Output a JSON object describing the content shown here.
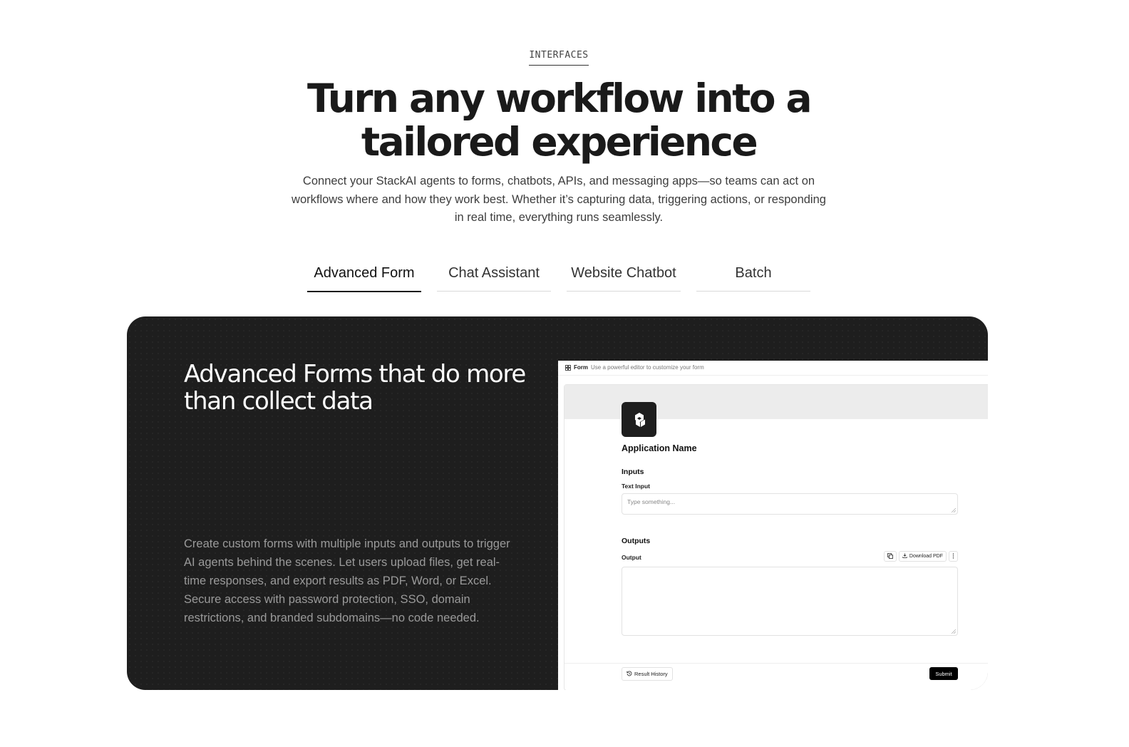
{
  "section": {
    "eyebrow": "INTERFACES",
    "headline_line1": "Turn any workflow into a",
    "headline_line2": "tailored experience",
    "subtitle": "Connect your StackAI agents to forms, chatbots, APIs, and messaging apps—so teams can act on workflows where and how they work best. Whether it’s capturing data, triggering actions, or responding in real time, everything runs seamlessly."
  },
  "tabs": [
    {
      "label": "Advanced Form",
      "active": true
    },
    {
      "label": "Chat Assistant",
      "active": false
    },
    {
      "label": "Website Chatbot",
      "active": false
    },
    {
      "label": "Batch",
      "active": false
    }
  ],
  "panel": {
    "title": "Advanced Forms that do more than collect data",
    "description": "Create custom forms with multiple inputs and outputs to trigger AI agents behind the scenes. Let users upload files, get real-time responses, and export results as PDF, Word, or Excel. Secure access with password protection, SSO, domain restrictions, and branded subdomains—no code needed."
  },
  "preview": {
    "header_title": "Form",
    "header_hint": "Use a powerful editor to customize your form",
    "app_name": "Application Name",
    "inputs_label": "Inputs",
    "text_input_label": "Text Input",
    "text_input_placeholder": "Type something...",
    "outputs_label": "Outputs",
    "output_label": "Output",
    "download_label": "Download PDF",
    "history_label": "Result History",
    "submit_label": "Submit",
    "icons": [
      "grid-icon",
      "app-logo-icon",
      "copy-icon",
      "download-icon",
      "more-icon",
      "history-icon"
    ]
  },
  "colors": {
    "panel_bg": "#1e1e1e",
    "headline": "#1a1a1a",
    "panel_desc": "#9a9a9a",
    "submit_bg": "#000000"
  }
}
